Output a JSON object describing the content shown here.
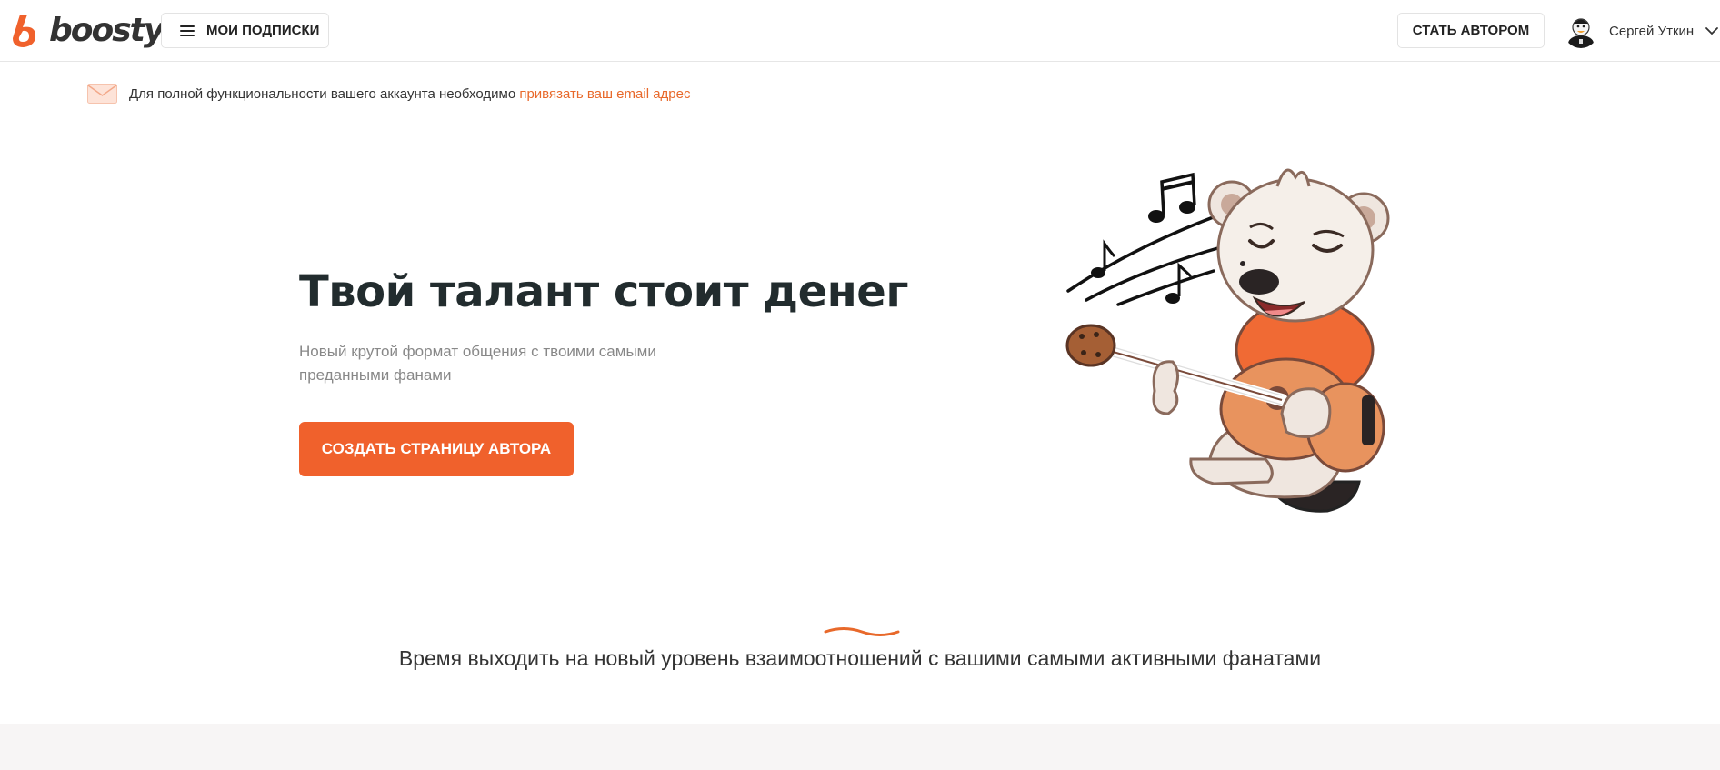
{
  "header": {
    "logo_text": "boosty",
    "subscriptions_label": "МОИ ПОДПИСКИ",
    "become_author_label": "СТАТЬ АВТОРОМ",
    "user_name": "Сергей Уткин"
  },
  "notice": {
    "text": "Для полной функциональности вашего аккаунта необходимо",
    "link_text": "привязать ваш email адрес"
  },
  "hero": {
    "title": "Твой талант стоит денег",
    "subtitle": "Новый крутой формат общения с твоими самыми преданными фанами",
    "cta_label": "СОЗДАТЬ СТРАНИЦУ АВТОРА"
  },
  "tagline": "Время выходить на новый уровень взаимоотношений с вашими самыми активными фанатами",
  "icons": [
    "boosty-logo-icon",
    "menu-icon",
    "avatar",
    "chevron-down-icon",
    "mail-icon",
    "bear-guitar-illustration"
  ],
  "colors": {
    "accent": "#f0612c",
    "link": "#e8692b",
    "title": "#222c2e",
    "muted": "#888888",
    "footer_band": "#f7f5f5"
  }
}
